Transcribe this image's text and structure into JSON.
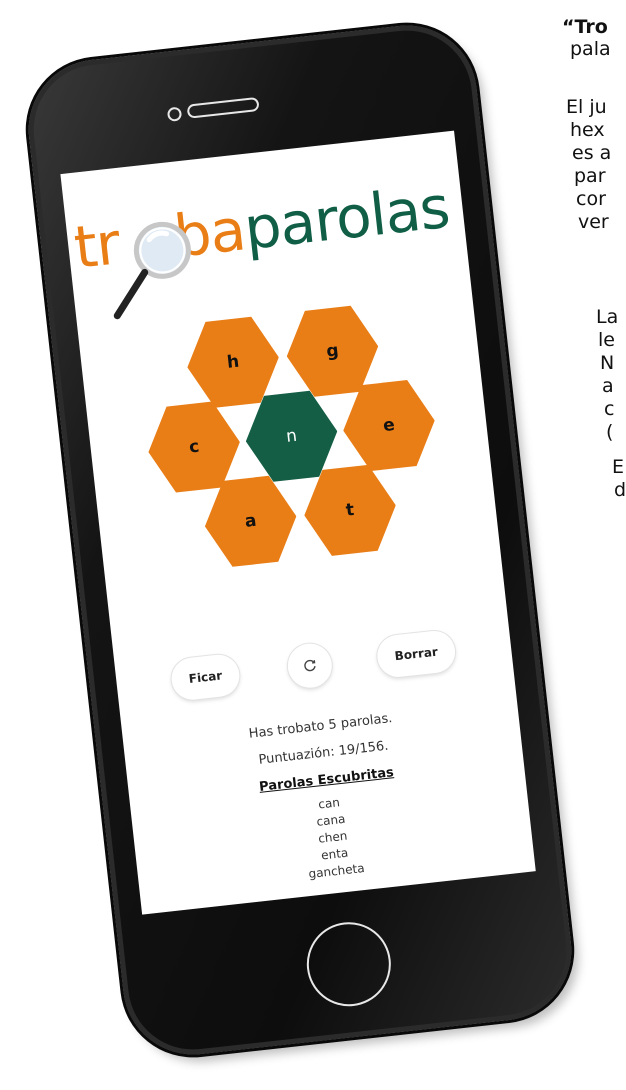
{
  "article": {
    "lines": [
      "“Tro",
      "pala",
      "El ju",
      "hex",
      "es a",
      "par",
      "cor",
      "ver",
      "La",
      "le",
      "N",
      "a",
      "c",
      "(",
      "E",
      "d"
    ]
  },
  "app": {
    "logo_part1": "tr",
    "logo_part2": "baparolas",
    "logo_part2_orange": "ba",
    "logo_part2_green": "parolas"
  },
  "hive": {
    "center_letter": "n",
    "outer_letters": {
      "top_left": "h",
      "top_right": "g",
      "left": "c",
      "right": "e",
      "bottom_left": "a",
      "bottom_right": "t"
    },
    "colors": {
      "outer": "#e97d16",
      "center": "#145e45"
    }
  },
  "controls": {
    "enter_label": "Ficar",
    "shuffle_icon": "refresh-icon",
    "delete_label": "Borrar"
  },
  "stats": {
    "found_text": "Has trobato 5 parolas.",
    "score_text": "Puntuazión: 19/156.",
    "words_heading": "Parolas Escubritas",
    "words": [
      "can",
      "cana",
      "chen",
      "enta",
      "gancheta"
    ]
  }
}
